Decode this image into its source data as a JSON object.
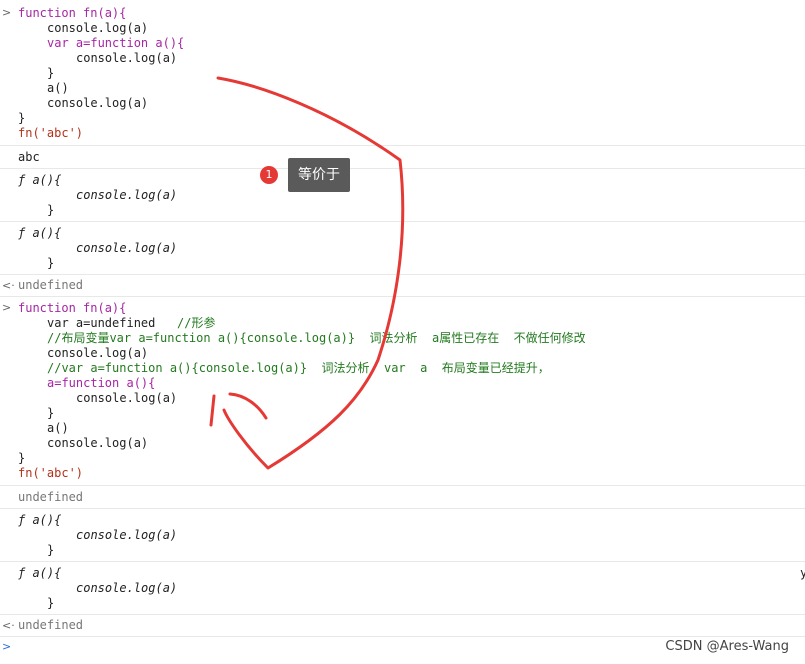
{
  "colors": {
    "keyword": "#a626a4",
    "string": "#b4321a",
    "comment": "#237a1f",
    "annotation_stroke": "#e53935",
    "tooltip_bg": "#5a5a5a"
  },
  "block1": {
    "l1": "function fn(a){",
    "l2": "console.log(a)",
    "l3": "var a=function a(){",
    "l4": "console.log(a)",
    "l5": "}",
    "l6": "a()",
    "l7": "console.log(a)",
    "l8": "}",
    "l9": "fn('abc')"
  },
  "out1": {
    "abc": "abc",
    "f1_head": "ƒ a(){",
    "f1_body": "console.log(a)",
    "f1_end": "}",
    "f2_head": "ƒ a(){",
    "f2_body": "console.log(a)",
    "f2_end": "}",
    "undef": "undefined"
  },
  "block2": {
    "l1": "function fn(a){",
    "l2_code": "var a=undefined   ",
    "l2_comment": "//形参",
    "l3_comment": "//布局变量var a=function a(){console.log(a)}  词法分析  a属性已存在  不做任何修改",
    "l4": "console.log(a)",
    "l5_comment": "//var a=function a(){console.log(a)}  词法分析  var  a  布局变量已经提升，",
    "l6": "a=function a(){",
    "l7": "console.log(a)",
    "l8": "}",
    "l9": "a()",
    "l10": "console.log(a)",
    "l11": "}",
    "l12": "fn('abc')"
  },
  "out2": {
    "undef1": "undefined",
    "f1_head": "ƒ a(){",
    "f1_body": "console.log(a)",
    "f1_end": "}",
    "f2_head": "ƒ a(){",
    "f2_body": "console.log(a)",
    "f2_end": "}",
    "undef2": "undefined"
  },
  "annotation": {
    "badge_number": "1",
    "tooltip_text": "等价于"
  },
  "prompts": {
    "input": ">",
    "result": "<·",
    "empty_input": ">"
  },
  "edge_char": "y",
  "watermark": "CSDN @Ares-Wang"
}
